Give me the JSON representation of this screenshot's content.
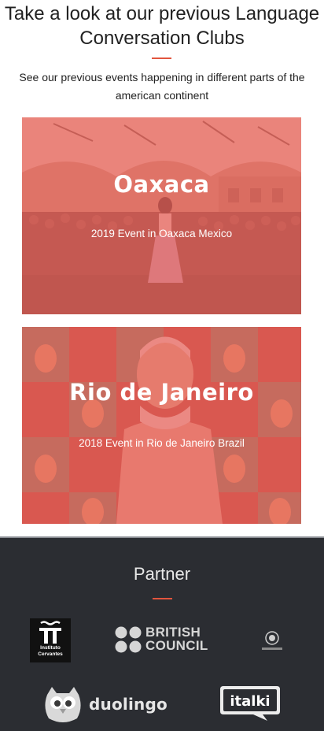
{
  "header": {
    "title": "Take a look at our previous Language Conversation Clubs",
    "subtitle": "See our previous events happening in different parts of the american continent"
  },
  "events": [
    {
      "city": "Oaxaca",
      "description": "2019 Event in Oaxaca Mexico"
    },
    {
      "city": "Rio de Janeiro",
      "description": "2018 Event in Rio de Janeiro Brazil"
    }
  ],
  "partners": {
    "title": "Partner",
    "logos": {
      "cervantes": {
        "name": "Instituto Cervantes",
        "line1": "Instituto",
        "line2": "Cervantes"
      },
      "british_council": {
        "line1": "BRITISH",
        "line2": "COUNCIL"
      },
      "small": {
        "icon": "seal-logo-icon"
      },
      "duolingo": {
        "text": "duolingo"
      },
      "italki": {
        "text": "italki"
      }
    }
  },
  "colors": {
    "accent": "#e2553e",
    "card_overlay": "#e86058",
    "footer_bg": "#2b2d32"
  }
}
